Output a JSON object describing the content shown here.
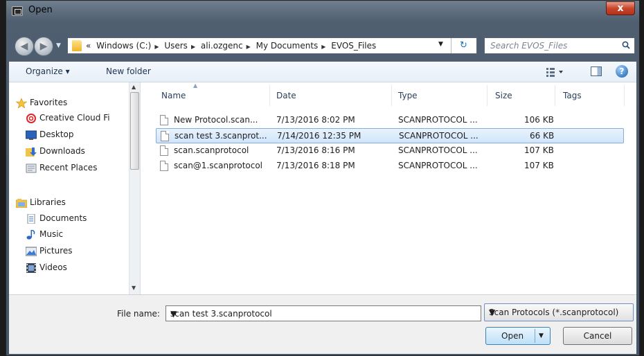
{
  "window": {
    "title": "Open",
    "close_label": "x"
  },
  "address": {
    "overflow": "«",
    "segments": [
      "Windows (C:)",
      "Users",
      "ali.ozgenc",
      "My Documents",
      "EVOS_Files"
    ]
  },
  "search": {
    "placeholder": "Search EVOS_Files"
  },
  "toolbar": {
    "organize_label": "Organize ▾",
    "new_folder_label": "New folder"
  },
  "sidebar": {
    "favorites_label": "Favorites",
    "favorites": [
      "Creative Cloud Fi",
      "Desktop",
      "Downloads",
      "Recent Places"
    ],
    "libraries_label": "Libraries",
    "libraries": [
      "Documents",
      "Music",
      "Pictures",
      "Videos"
    ]
  },
  "filelist": {
    "columns": {
      "name": "Name",
      "date": "Date",
      "type": "Type",
      "size": "Size",
      "tags": "Tags"
    },
    "rows": [
      {
        "name": "New Protocol.scan...",
        "date": "7/13/2016 8:02 PM",
        "type": "SCANPROTOCOL ...",
        "size": "106 KB"
      },
      {
        "name": "scan test 3.scanprot...",
        "date": "7/14/2016 12:35 PM",
        "type": "SCANPROTOCOL ...",
        "size": "66 KB"
      },
      {
        "name": "scan.scanprotocol",
        "date": "7/13/2016 8:16 PM",
        "type": "SCANPROTOCOL ...",
        "size": "107 KB"
      },
      {
        "name": "scan@1.scanprotocol",
        "date": "7/13/2016 8:18 PM",
        "type": "SCANPROTOCOL ...",
        "size": "107 KB"
      }
    ],
    "selected_index": 1
  },
  "bottom": {
    "file_name_label": "File name:",
    "file_name_value": "scan test 3.scanprotocol",
    "file_type_value": "Scan Protocols (*.scanprotocol)",
    "open_label": "Open",
    "cancel_label": "Cancel"
  }
}
